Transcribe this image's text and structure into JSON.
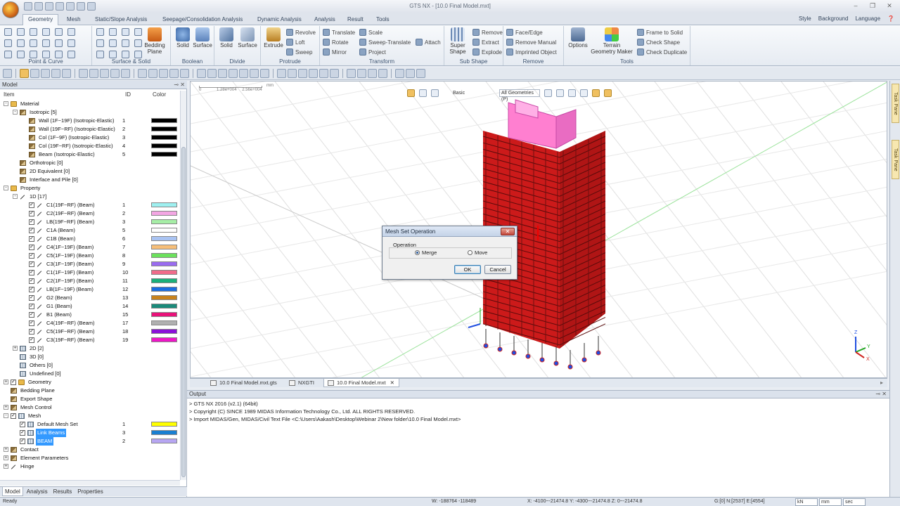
{
  "window": {
    "title": "GTS NX - [10.0 Final Model.mxt]"
  },
  "ribbon_tabs": [
    "Geometry",
    "Mesh",
    "Static/Slope Analysis",
    "Seepage/Consolidation Analysis",
    "Dynamic Analysis",
    "Analysis",
    "Result",
    "Tools"
  ],
  "ribbon_right": [
    "Style",
    "Background",
    "Language"
  ],
  "ribbon": {
    "groups": {
      "point_curve": "Point & Curve",
      "surface_solid": "Surface & Solid",
      "boolean": "Boolean",
      "divide": "Divide",
      "protrude": "Protrude",
      "transform": "Transform",
      "sub_shape": "Sub Shape",
      "remove": "Remove",
      "tools": "Tools"
    },
    "bedding_plane": "Bedding Plane",
    "boolean_solid": "Solid",
    "boolean_surface": "Surface",
    "divide_solid": "Solid",
    "divide_surface": "Surface",
    "extrude": "Extrude",
    "revolve": "Revolve",
    "loft": "Loft",
    "sweep": "Sweep",
    "translate": "Translate",
    "rotate": "Rotate",
    "mirror": "Mirror",
    "scale": "Scale",
    "sweep_translate": "Sweep-Translate",
    "project": "Project",
    "attach": "Attach",
    "super_shape": "Super Shape",
    "sub_remove": "Remove",
    "extract": "Extract",
    "explode": "Explode",
    "face_edge": "Face/Edge",
    "remove_manual": "Remove Manual",
    "imprinted_object": "Imprinted Object",
    "options": "Options",
    "terrain_geometry_maker": "Terrain Geometry Maker",
    "frame_to_solid": "Frame to Solid",
    "check_shape": "Check Shape",
    "check_duplicate": "Check Duplicate"
  },
  "model_panel": {
    "title": "Model",
    "columns": {
      "item": "Item",
      "id": "ID",
      "color": "Color"
    },
    "tree": [
      {
        "label": "Material",
        "level": 0,
        "exp": "-",
        "icon": "folder"
      },
      {
        "label": "Isotropic [5]",
        "level": 1,
        "exp": "-",
        "icon": "mat"
      },
      {
        "label": "Wall (1F~19F) (Isotropic-Elastic)",
        "level": 2,
        "icon": "mat",
        "id": "1",
        "color": "#000000"
      },
      {
        "label": "Wall (19F~RF) (Isotropic-Elastic)",
        "level": 2,
        "icon": "mat",
        "id": "2",
        "color": "#000000"
      },
      {
        "label": "Col (1F~9F) (Isotropic-Elastic)",
        "level": 2,
        "icon": "mat",
        "id": "3",
        "color": "#000000"
      },
      {
        "label": "Col (19F~RF) (Isotropic-Elastic)",
        "level": 2,
        "icon": "mat",
        "id": "4",
        "color": "#000000"
      },
      {
        "label": "Beam (Isotropic-Elastic)",
        "level": 2,
        "icon": "mat",
        "id": "5",
        "color": "#000000"
      },
      {
        "label": "Orthotropic [0]",
        "level": 1,
        "icon": "mat"
      },
      {
        "label": "2D Equivalent [0]",
        "level": 1,
        "icon": "mat"
      },
      {
        "label": "Interface and Pile [0]",
        "level": 1,
        "icon": "mat"
      },
      {
        "label": "Property",
        "level": 0,
        "exp": "-",
        "icon": "folder"
      },
      {
        "label": "1D [17]",
        "level": 1,
        "exp": "-",
        "icon": "line"
      },
      {
        "label": "C1(19F~RF) (Beam)",
        "level": 2,
        "chk": true,
        "icon": "line",
        "id": "1",
        "color": "#9ef0f0"
      },
      {
        "label": "C2(19F~RF) (Beam)",
        "level": 2,
        "chk": true,
        "icon": "line",
        "id": "2",
        "color": "#f3a6e3"
      },
      {
        "label": "LB(19F~RF) (Beam)",
        "level": 2,
        "chk": true,
        "icon": "line",
        "id": "3",
        "color": "#a6eea6"
      },
      {
        "label": "C1A (Beam)",
        "level": 2,
        "chk": true,
        "icon": "line",
        "id": "5",
        "color": "#ffffff"
      },
      {
        "label": "C1B (Beam)",
        "level": 2,
        "chk": true,
        "icon": "line",
        "id": "6",
        "color": "#a9c3f2"
      },
      {
        "label": "C4(1F~19F) (Beam)",
        "level": 2,
        "chk": true,
        "icon": "line",
        "id": "7",
        "color": "#f6be78"
      },
      {
        "label": "C5(1F~19F) (Beam)",
        "level": 2,
        "chk": true,
        "icon": "line",
        "id": "8",
        "color": "#6be05c"
      },
      {
        "label": "C3(1F~19F) (Beam)",
        "level": 2,
        "chk": true,
        "icon": "line",
        "id": "9",
        "color": "#9a6cf0"
      },
      {
        "label": "C1(1F~19F) (Beam)",
        "level": 2,
        "chk": true,
        "icon": "line",
        "id": "10",
        "color": "#f06c8a"
      },
      {
        "label": "C2(1F~19F) (Beam)",
        "level": 2,
        "chk": true,
        "icon": "line",
        "id": "11",
        "color": "#1ab07a"
      },
      {
        "label": "LB(1F~19F) (Beam)",
        "level": 2,
        "chk": true,
        "icon": "line",
        "id": "12",
        "color": "#1a6ee0"
      },
      {
        "label": "G2 (Beam)",
        "level": 2,
        "chk": true,
        "icon": "line",
        "id": "13",
        "color": "#c8821c"
      },
      {
        "label": "G1 (Beam)",
        "level": 2,
        "chk": true,
        "icon": "line",
        "id": "14",
        "color": "#1a8a7a"
      },
      {
        "label": "B1 (Beam)",
        "level": 2,
        "chk": true,
        "icon": "line",
        "id": "15",
        "color": "#e8127a"
      },
      {
        "label": "C4(19F~RF) (Beam)",
        "level": 2,
        "chk": true,
        "icon": "line",
        "id": "17",
        "color": "#b0b0b0"
      },
      {
        "label": "C5(19F~RF) (Beam)",
        "level": 2,
        "chk": true,
        "icon": "line",
        "id": "18",
        "color": "#8a12d8"
      },
      {
        "label": "C3(19F~RF) (Beam)",
        "level": 2,
        "chk": true,
        "icon": "line",
        "id": "19",
        "color": "#ee16c8"
      },
      {
        "label": "2D [2]",
        "level": 1,
        "exp": "+",
        "icon": "mesh"
      },
      {
        "label": "3D [0]",
        "level": 1,
        "icon": "mesh"
      },
      {
        "label": "Others [0]",
        "level": 1,
        "icon": "mesh"
      },
      {
        "label": "Undefined [0]",
        "level": 1,
        "icon": "mesh"
      },
      {
        "label": "Geometry",
        "level": 0,
        "exp": "+",
        "chk": true,
        "icon": "folder"
      },
      {
        "label": "Bedding Plane",
        "level": 0,
        "icon": "mat"
      },
      {
        "label": "Export Shape",
        "level": 0,
        "icon": "mat"
      },
      {
        "label": "Mesh Control",
        "level": 0,
        "exp": "+",
        "icon": "mat"
      },
      {
        "label": "Mesh",
        "level": 0,
        "exp": "-",
        "chk": true,
        "icon": "mesh"
      },
      {
        "label": "Default Mesh Set",
        "level": 1,
        "chk": true,
        "icon": "mesh",
        "id": "1",
        "color": "#ffff00"
      },
      {
        "label": "Link Beams",
        "level": 1,
        "chk": true,
        "icon": "mesh",
        "id": "3",
        "color": "#1a7fd0",
        "selected": true
      },
      {
        "label": "BEAM",
        "level": 1,
        "chk": true,
        "icon": "mesh",
        "id": "2",
        "color": "#b7a6f2",
        "selected": true
      },
      {
        "label": "Contact",
        "level": 0,
        "exp": "+",
        "icon": "mat"
      },
      {
        "label": "Element Parameters",
        "level": 0,
        "exp": "+",
        "icon": "mat"
      },
      {
        "label": "Hinge",
        "level": 0,
        "exp": "+",
        "icon": "line"
      }
    ],
    "bottom_tabs": [
      "Model",
      "Analysis",
      "Results",
      "Properties"
    ]
  },
  "viewport": {
    "view_mode": "Basic",
    "filter": "All Geometries (P)",
    "scale_labels": [
      "0",
      "1.28e+004",
      "2.56e+004"
    ],
    "scale_unit": "mm",
    "axis_labels": {
      "x": "X",
      "y": "Y",
      "z": "Z"
    }
  },
  "doc_tabs": [
    "10.0 Final Model.mxt.gts",
    "NXGTI",
    "10.0 Final Model.mxt"
  ],
  "task_pane_tabs": [
    "Task Pane",
    "Task Pane"
  ],
  "output": {
    "title": "Output",
    "lines": [
      "> GTS NX 2016 (v2.1) (64bit)",
      "> Copyright (C) SINCE 1989 MIDAS Information Technology Co., Ltd. ALL RIGHTS RESERVED.",
      "> Import MIDAS/Gen, MIDAS/Civil Text File <C:\\Users\\Aakash\\Desktop\\Webinar 2\\New folder\\10.0 Final Model.mxt>"
    ]
  },
  "status": {
    "ready": "Ready",
    "width": "W: -188764 -118489",
    "coords": "X: -4100~-21474.8 Y: -4300~-21474.8 Z: 0~-21474.8",
    "counts": "G:[0] N:[2537] E:[4554]",
    "force_unit": "kN",
    "length_unit": "mm",
    "time_unit": "sec"
  },
  "dialog": {
    "title": "Mesh Set Operation",
    "group": "Operation",
    "options": [
      "Merge",
      "Move"
    ],
    "selected": "Merge",
    "ok": "OK",
    "cancel": "Cancel"
  },
  "colors": {
    "building_frame": "#cc1a1a",
    "roof": "#ff7fd0",
    "selection": "#3399ff"
  }
}
